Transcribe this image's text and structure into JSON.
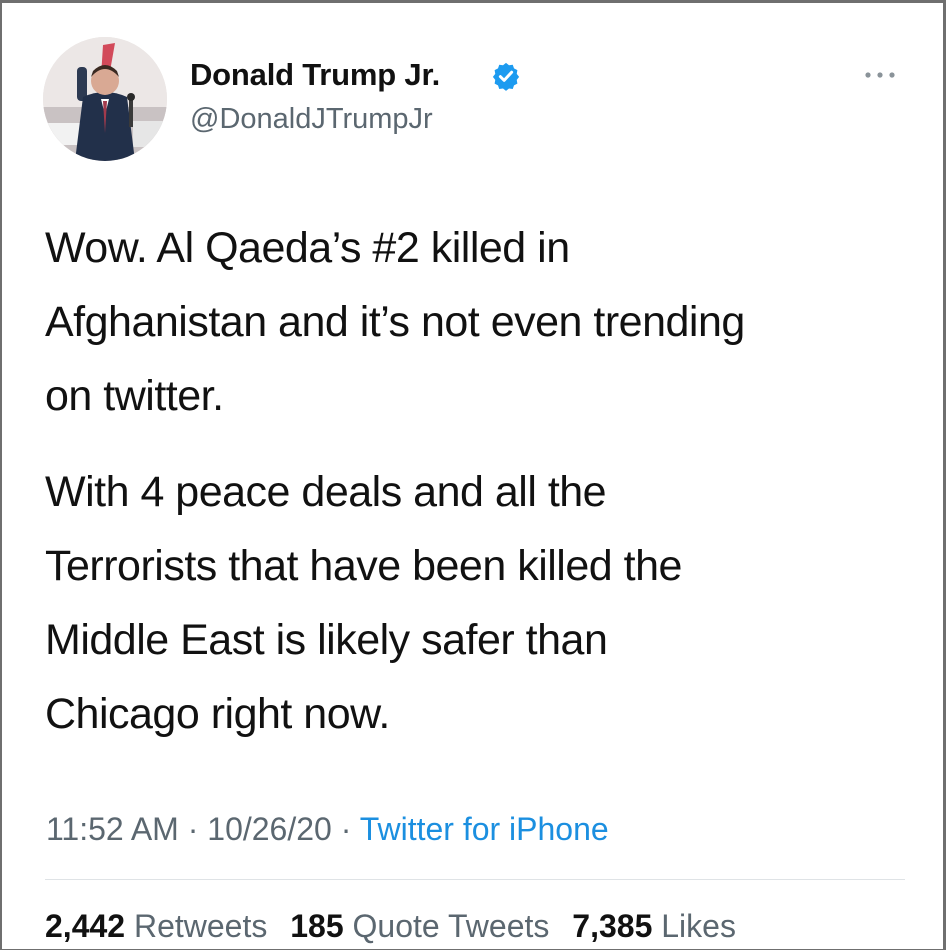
{
  "tweet": {
    "author": {
      "display_name": "Donald Trump Jr.",
      "handle": "@DonaldJTrumpJr",
      "verified": true,
      "avatar_icon": "profile-photo",
      "verified_icon": "verified-badge-icon"
    },
    "more_icon": "more-options-icon",
    "paragraphs": [
      "Wow. Al Qaeda’s #2 killed in\nAfghanistan and it’s not even trending\non twitter.",
      "With 4 peace deals and all the\nTerrorists that have been killed the\nMiddle East is likely safer than\nChicago right now."
    ],
    "meta": {
      "time": "11:52 AM",
      "separator": " · ",
      "date": "10/26/20",
      "source": "Twitter for iPhone"
    },
    "stats": {
      "retweets_count": "2,442",
      "retweets_label": "Retweets",
      "quote_tweets_count": "185",
      "quote_tweets_label": "Quote Tweets",
      "likes_count": "7,385",
      "likes_label": "Likes"
    }
  },
  "colors": {
    "text": "#111111",
    "secondary": "#5b6770",
    "link": "#1b8fe0",
    "verified": "#1d9bf0",
    "border": "#6f6f6f"
  }
}
